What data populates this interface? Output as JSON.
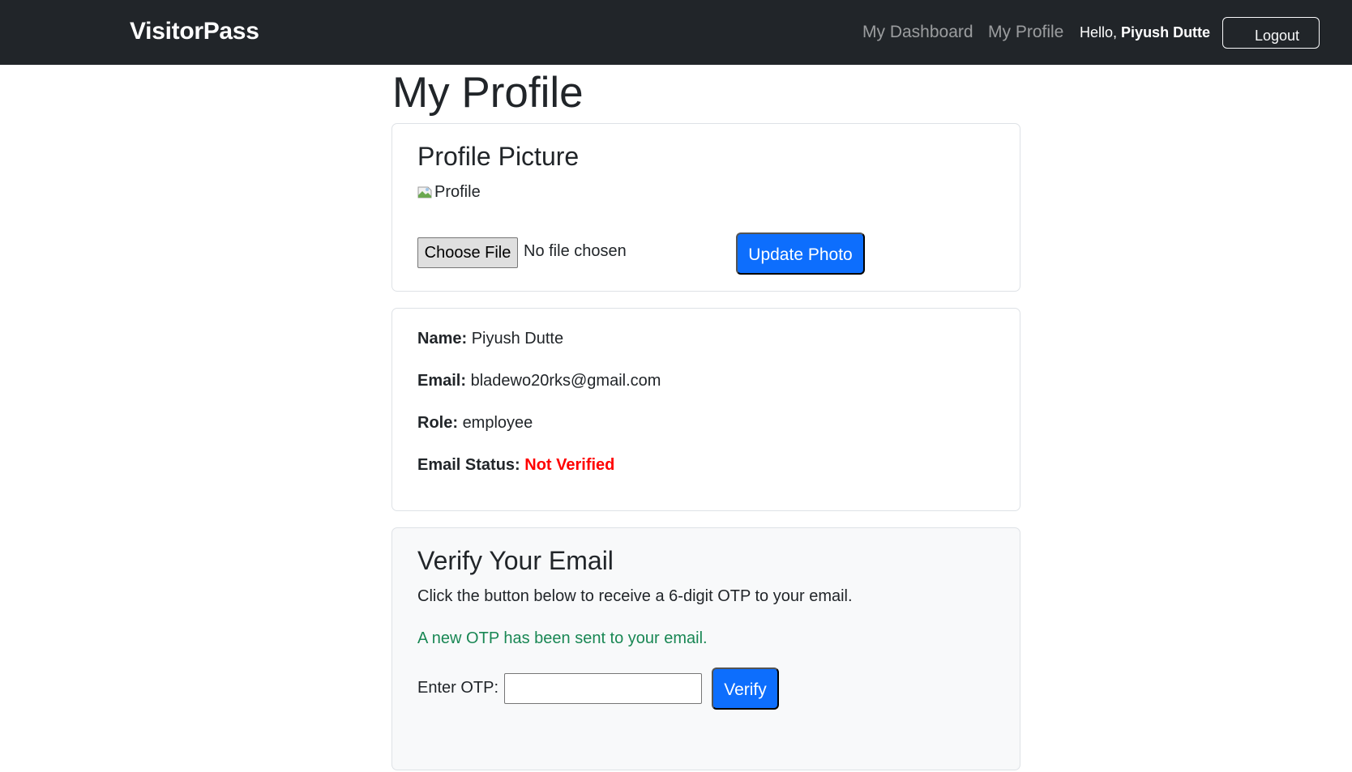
{
  "navbar": {
    "brand": "VisitorPass",
    "links": [
      {
        "label": "My Dashboard"
      },
      {
        "label": "My Profile"
      }
    ],
    "greeting_prefix": "Hello,",
    "greeting_name": "Piyush Dutte",
    "logout_label": "Logout"
  },
  "page": {
    "title": "My Profile"
  },
  "profile_picture": {
    "title": "Profile Picture",
    "image_alt": "Profile",
    "choose_file_label": "Choose File",
    "file_status": "No file chosen",
    "update_button": "Update Photo"
  },
  "info": {
    "name_label": "Name:",
    "name_value": "Piyush Dutte",
    "email_label": "Email:",
    "email_value": "bladewo20rks@gmail.com",
    "role_label": "Role:",
    "role_value": "employee",
    "status_label": "Email Status:",
    "status_value": "Not Verified",
    "status_color": "#ff0000"
  },
  "verify": {
    "title": "Verify Your Email",
    "description": "Click the button below to receive a 6-digit OTP to your email.",
    "message": "A new OTP has been sent to your email.",
    "message_color": "#198754",
    "otp_label": "Enter OTP:",
    "otp_value": "",
    "otp_placeholder": "",
    "verify_button": "Verify"
  },
  "colors": {
    "navbar_bg": "#212529",
    "primary": "#0d6efd"
  }
}
